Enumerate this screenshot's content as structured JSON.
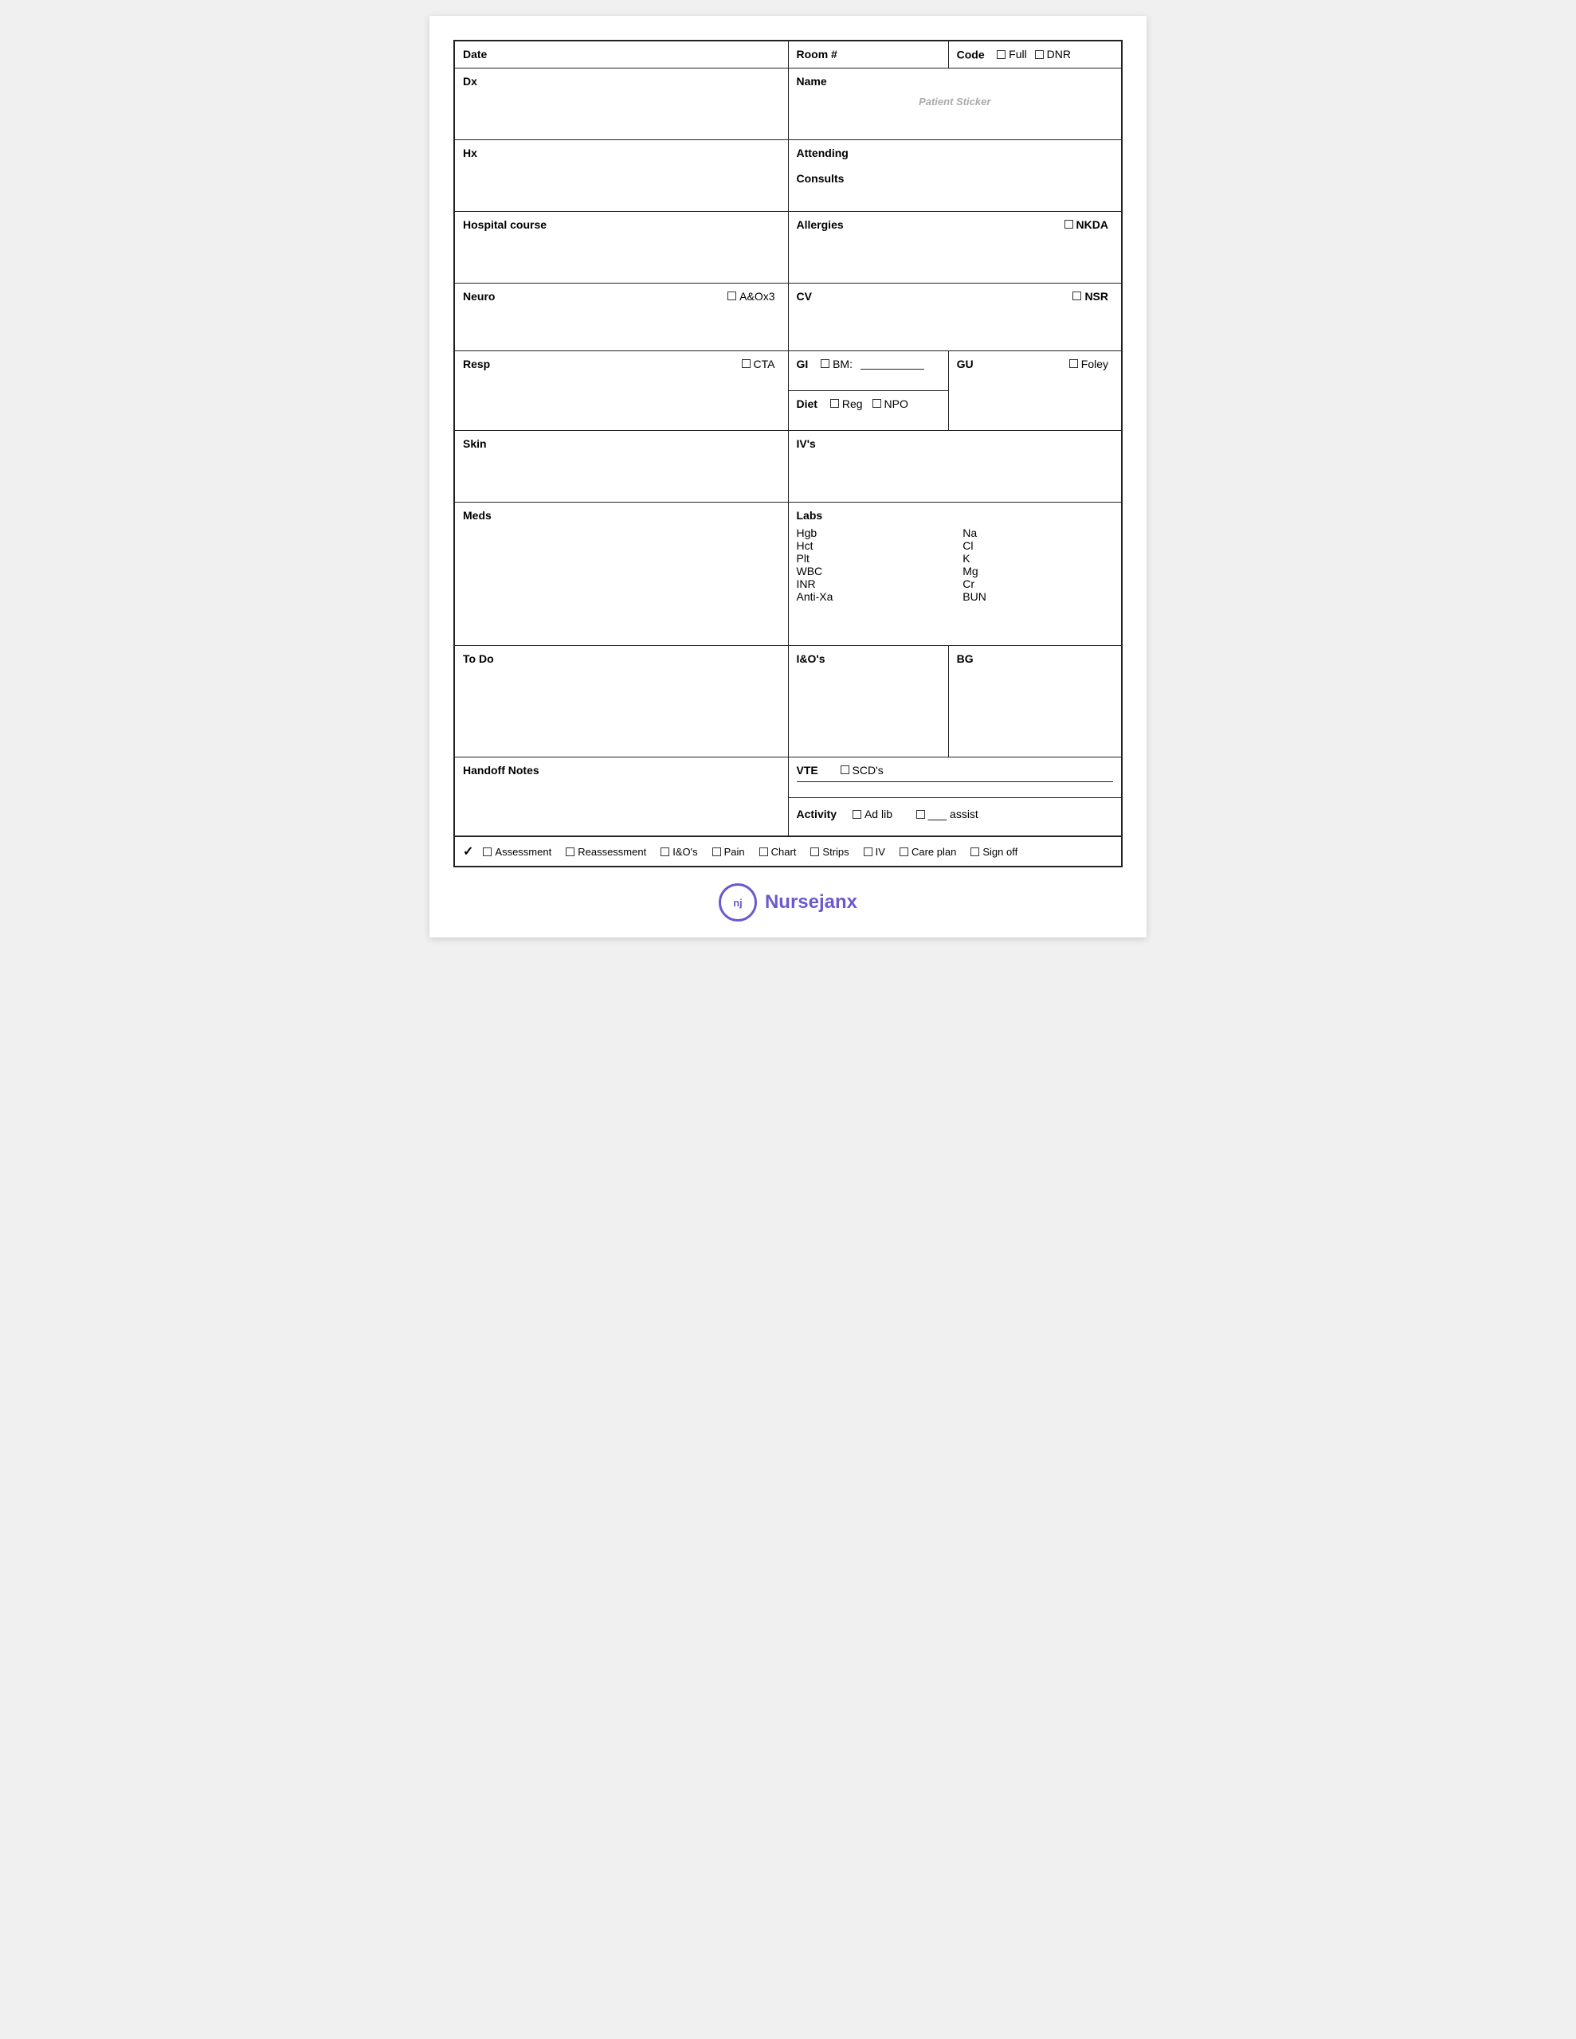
{
  "header": {
    "date_label": "Date",
    "room_label": "Room #",
    "code_label": "Code",
    "full_label": "Full",
    "dnr_label": "DNR"
  },
  "row1": {
    "dx_label": "Dx",
    "name_label": "Name",
    "patient_sticker": "Patient Sticker"
  },
  "row2": {
    "hx_label": "Hx",
    "attending_label": "Attending",
    "consults_label": "Consults"
  },
  "row3": {
    "hospital_course_label": "Hospital course",
    "allergies_label": "Allergies",
    "nkda_label": "NKDA"
  },
  "row4": {
    "neuro_label": "Neuro",
    "aox3_label": "A&Ox3",
    "cv_label": "CV",
    "nsr_label": "NSR"
  },
  "row5": {
    "resp_label": "Resp",
    "cta_label": "CTA",
    "gi_label": "GI",
    "bm_label": "BM:",
    "gu_label": "GU",
    "foley_label": "Foley",
    "diet_label": "Diet",
    "reg_label": "Reg",
    "npo_label": "NPO"
  },
  "row6": {
    "skin_label": "Skin",
    "ivs_label": "IV's"
  },
  "row7": {
    "meds_label": "Meds",
    "labs_label": "Labs",
    "labs_left": [
      "Hgb",
      "Hct",
      "Plt",
      "WBC",
      "INR",
      "Anti-Xa"
    ],
    "labs_right": [
      "Na",
      "Cl",
      "K",
      "Mg",
      "Cr",
      "BUN"
    ]
  },
  "row8": {
    "todo_label": "To Do",
    "ios_label": "I&O's",
    "bg_label": "BG"
  },
  "row9": {
    "handoff_label": "Handoff Notes",
    "vte_label": "VTE",
    "scds_label": "SCD's",
    "activity_label": "Activity",
    "ad_lib_label": "Ad lib",
    "assist_label": "___ assist"
  },
  "footer": {
    "checkmark": "✓",
    "assessment_label": "Assessment",
    "reassessment_label": "Reassessment",
    "ios_label": "I&O's",
    "pain_label": "Pain",
    "chart_label": "Chart",
    "strips_label": "Strips",
    "iv_label": "IV",
    "care_plan_label": "Care plan",
    "sign_off_label": "Sign off"
  },
  "logo": {
    "initials": "nj",
    "brand_nurse": "Nurse",
    "brand_janx": "janx"
  }
}
